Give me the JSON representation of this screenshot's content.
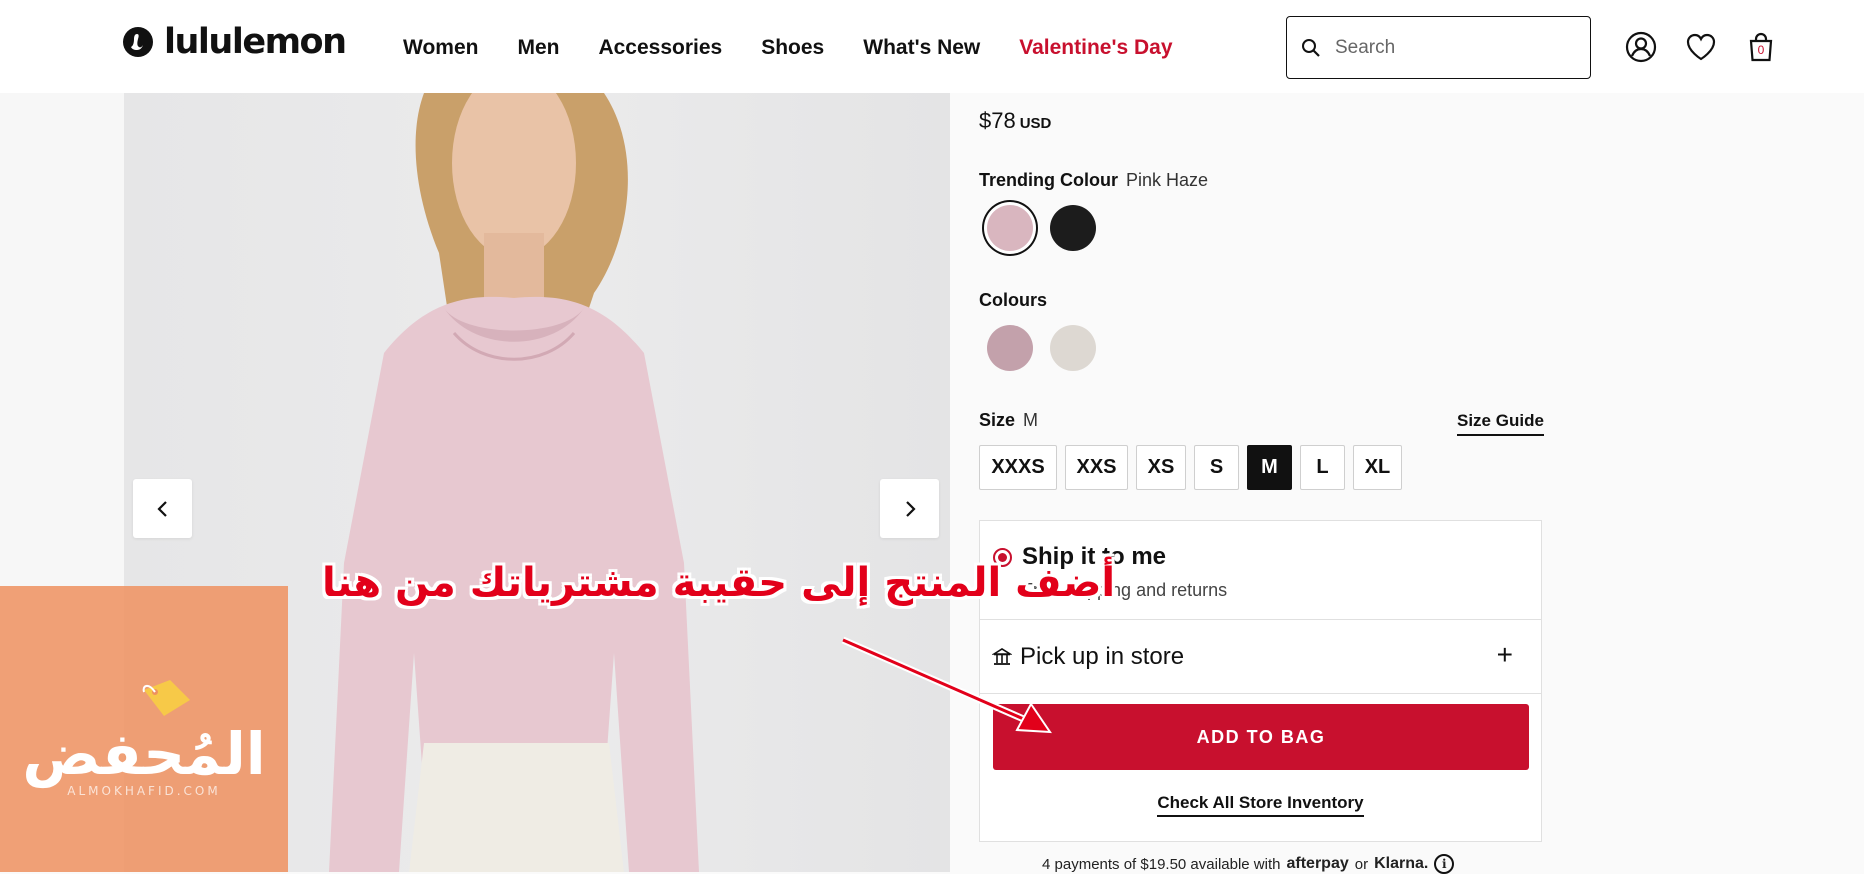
{
  "header": {
    "logo_text": "lululemon",
    "nav": [
      "Women",
      "Men",
      "Accessories",
      "Shoes",
      "What's New",
      "Valentine's Day"
    ],
    "search_placeholder": "Search",
    "bag_count": "0",
    "icons": [
      "search-icon",
      "account-icon",
      "heart-icon",
      "bag-icon"
    ]
  },
  "product": {
    "price": "$78",
    "currency": "USD",
    "trending_label": "Trending Colour",
    "trending_value": "Pink Haze",
    "trending_swatches": [
      {
        "color": "#d9b6bf",
        "selected": true
      },
      {
        "color": "#1c1c1c",
        "selected": false
      }
    ],
    "colours_label": "Colours",
    "colour_swatches": [
      {
        "color": "#c3a1ab"
      },
      {
        "color": "#ddd8d2"
      }
    ],
    "size_label": "Size",
    "size_value": "M",
    "size_guide": "Size Guide",
    "sizes": [
      {
        "label": "XXXS",
        "selected": false
      },
      {
        "label": "XXS",
        "selected": false
      },
      {
        "label": "XS",
        "selected": false
      },
      {
        "label": "S",
        "selected": false
      },
      {
        "label": "M",
        "selected": true
      },
      {
        "label": "L",
        "selected": false
      },
      {
        "label": "XL",
        "selected": false
      }
    ]
  },
  "fulfillment": {
    "ship_title": "Ship it to me",
    "ship_sub": "Free shipping and returns",
    "pickup_title": "Pick up in store",
    "add_to_bag": "ADD TO BAG",
    "check_inventory": "Check All Store Inventory"
  },
  "payments": {
    "text": "4 payments of $19.50 available with",
    "provider1": "afterpay",
    "or": "or",
    "provider2": "Klarna."
  },
  "annotation": {
    "text": "أضف المنتج إلى حقيبة مشترياتك من هنا",
    "color": "#e2001a"
  },
  "watermark": {
    "title": "المُحفض",
    "subtitle": "ALMOKHAFID.COM"
  },
  "colors": {
    "brand_red": "#c8102e"
  }
}
